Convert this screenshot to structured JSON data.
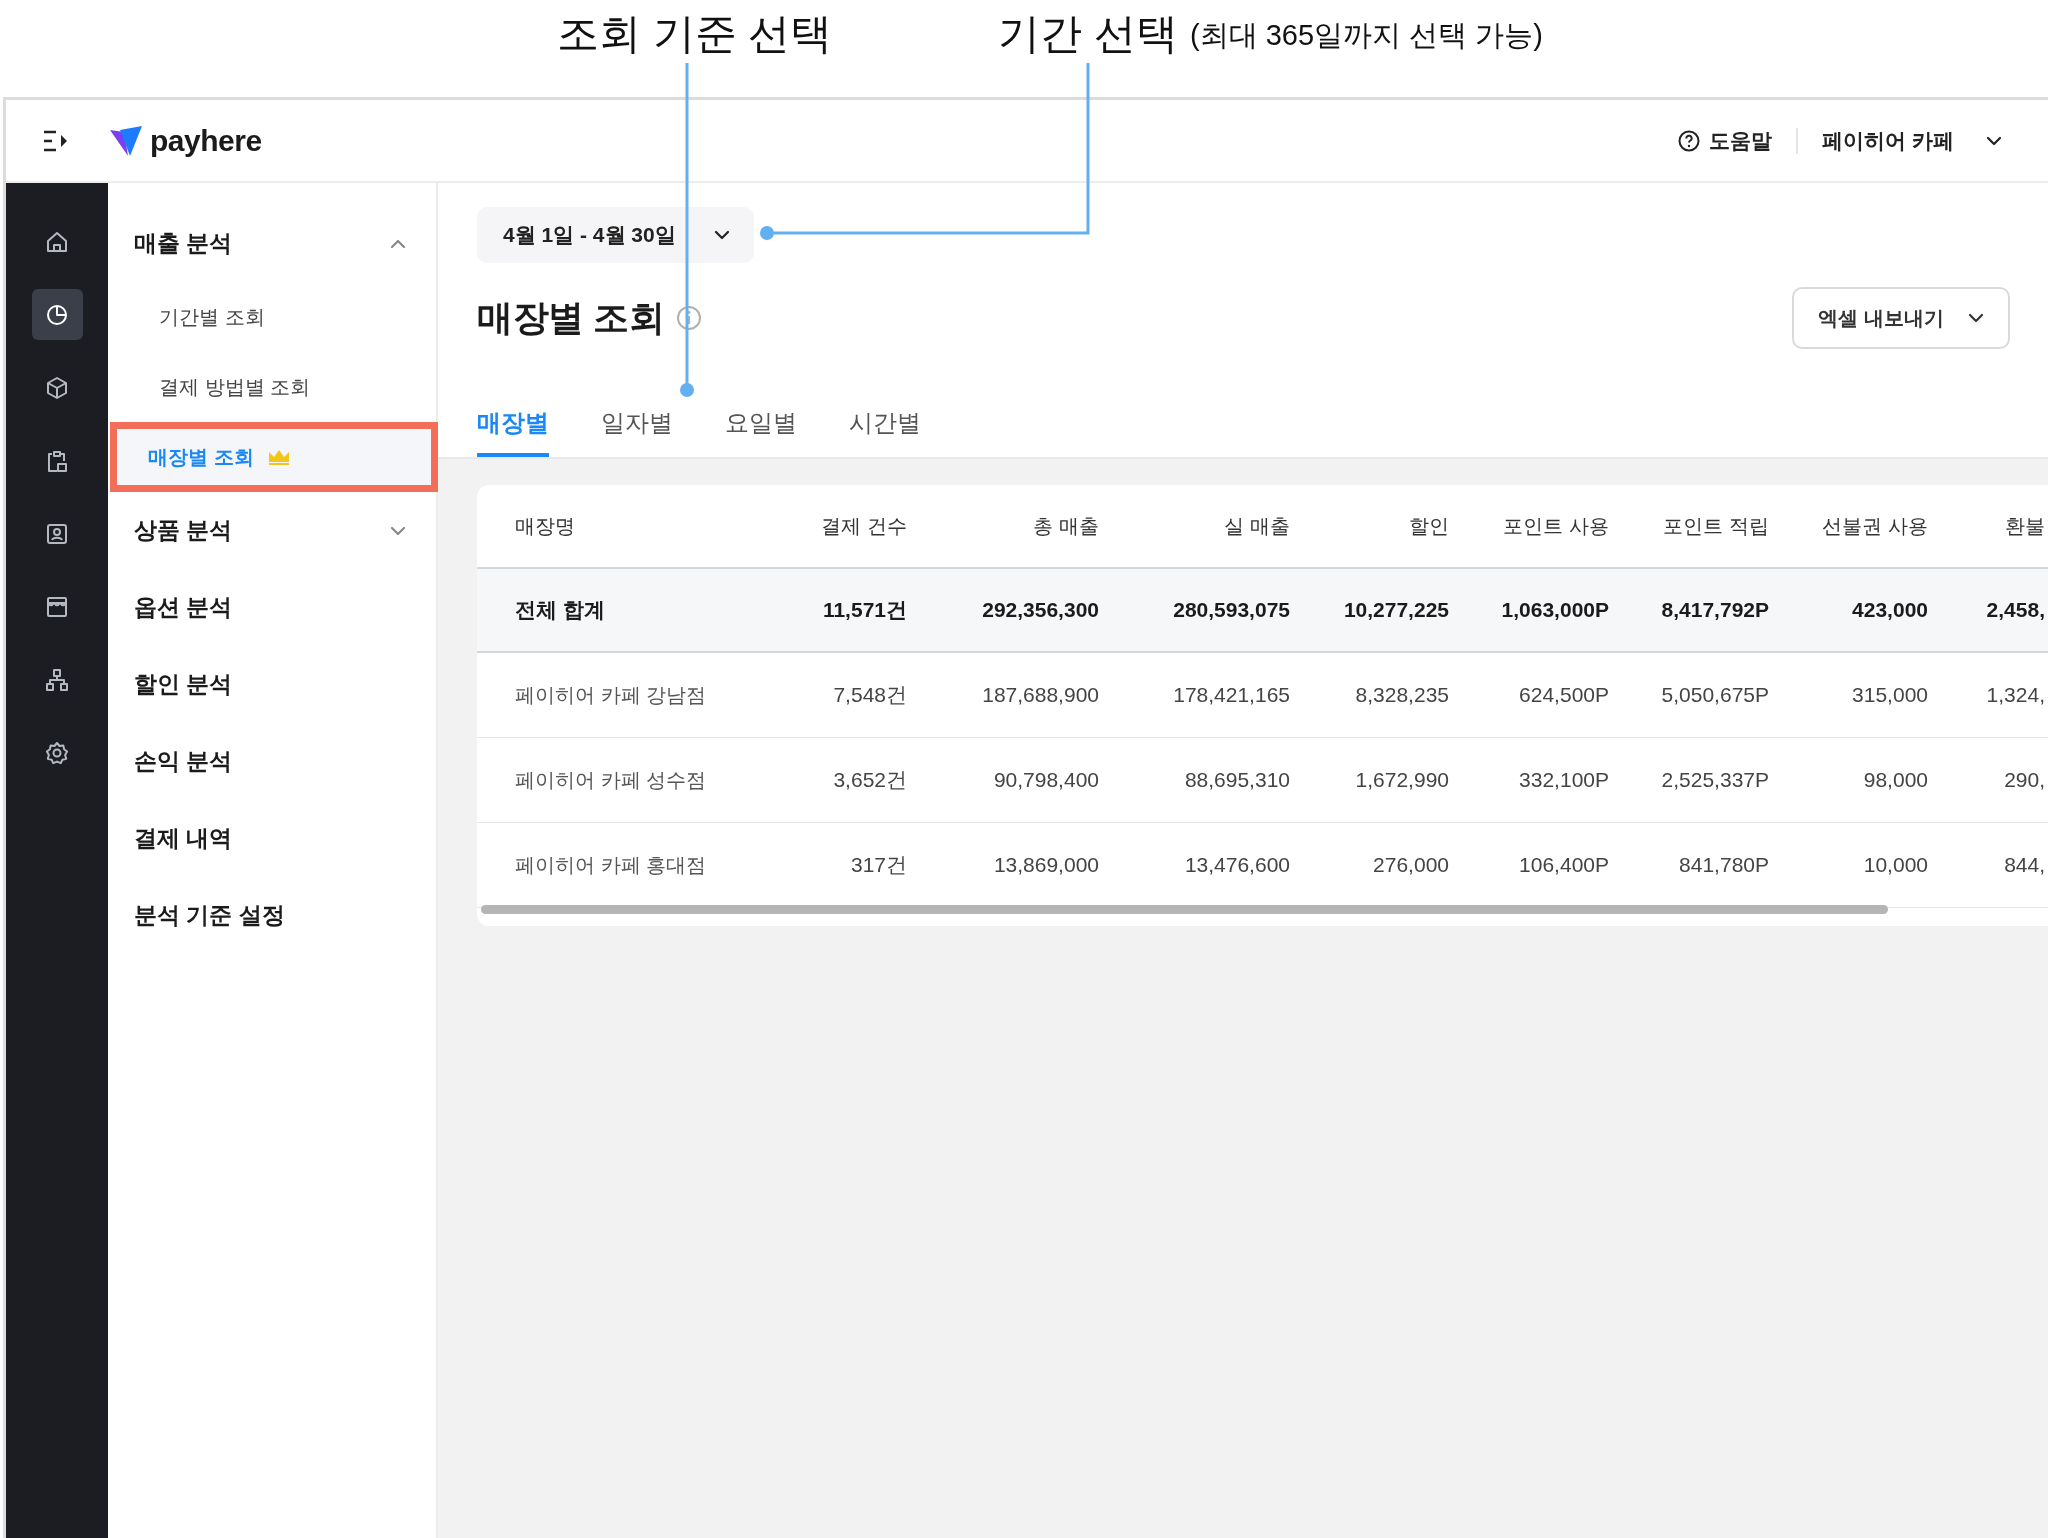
{
  "annotations": [
    {
      "label": "조회 기준 선택"
    },
    {
      "label": "기간 선택",
      "note": "(최대 365일까지 선택 가능)"
    }
  ],
  "header": {
    "logo": "payhere",
    "help": "도움말",
    "store": "페이히어 카페"
  },
  "rail": [
    {
      "kind": "home",
      "selected": false
    },
    {
      "kind": "chart",
      "selected": true
    },
    {
      "kind": "box",
      "selected": false
    },
    {
      "kind": "clipboard",
      "selected": false
    },
    {
      "kind": "contact",
      "selected": false
    },
    {
      "kind": "store",
      "selected": false
    },
    {
      "kind": "hierarchy",
      "selected": false
    },
    {
      "kind": "settings",
      "selected": false
    }
  ],
  "sidebar": [
    {
      "label": "매출 분석",
      "expanded": true,
      "children": [
        {
          "label": "기간별 조회",
          "selected": false,
          "premium": false,
          "highlighted": false
        },
        {
          "label": "결제 방법별 조회",
          "selected": false,
          "premium": false,
          "highlighted": false
        },
        {
          "label": "매장별 조회",
          "selected": true,
          "premium": true,
          "highlighted": true
        }
      ]
    },
    {
      "label": "상품 분석",
      "expanded": false
    },
    {
      "label": "옵션 분석"
    },
    {
      "label": "할인 분석"
    },
    {
      "label": "손익 분석"
    },
    {
      "label": "결제 내역"
    },
    {
      "label": "분석 기준 설정"
    }
  ],
  "date_range": {
    "value": "4월 1일 - 4월 30일"
  },
  "page_title": "매장별 조회",
  "export_button": "엑셀 내보내기",
  "tabs": [
    {
      "label": "매장별",
      "selected": true
    },
    {
      "label": "일자별",
      "selected": false
    },
    {
      "label": "요일별",
      "selected": false
    },
    {
      "label": "시간별",
      "selected": false
    }
  ],
  "table": {
    "columns": [
      "매장명",
      "결제 건수",
      "총 매출",
      "실 매출",
      "할인",
      "포인트 사용",
      "포인트 적립",
      "선불권 사용",
      "환불"
    ],
    "total": [
      "전체 합계",
      "11,571건",
      "292,356,300",
      "280,593,075",
      "10,277,225",
      "1,063,000P",
      "8,417,792P",
      "423,000",
      "2,458,"
    ],
    "rows": [
      [
        "페이히어 카페 강남점",
        "7,548건",
        "187,688,900",
        "178,421,165",
        "8,328,235",
        "624,500P",
        "5,050,675P",
        "315,000",
        "1,324,"
      ],
      [
        "페이히어 카페 성수점",
        "3,652건",
        "90,798,400",
        "88,695,310",
        "1,672,990",
        "332,100P",
        "2,525,337P",
        "98,000",
        "290,"
      ],
      [
        "페이히어 카페 홍대점",
        "317건",
        "13,869,000",
        "13,476,600",
        "276,000",
        "106,400P",
        "841,780P",
        "10,000",
        "844,"
      ]
    ]
  }
}
